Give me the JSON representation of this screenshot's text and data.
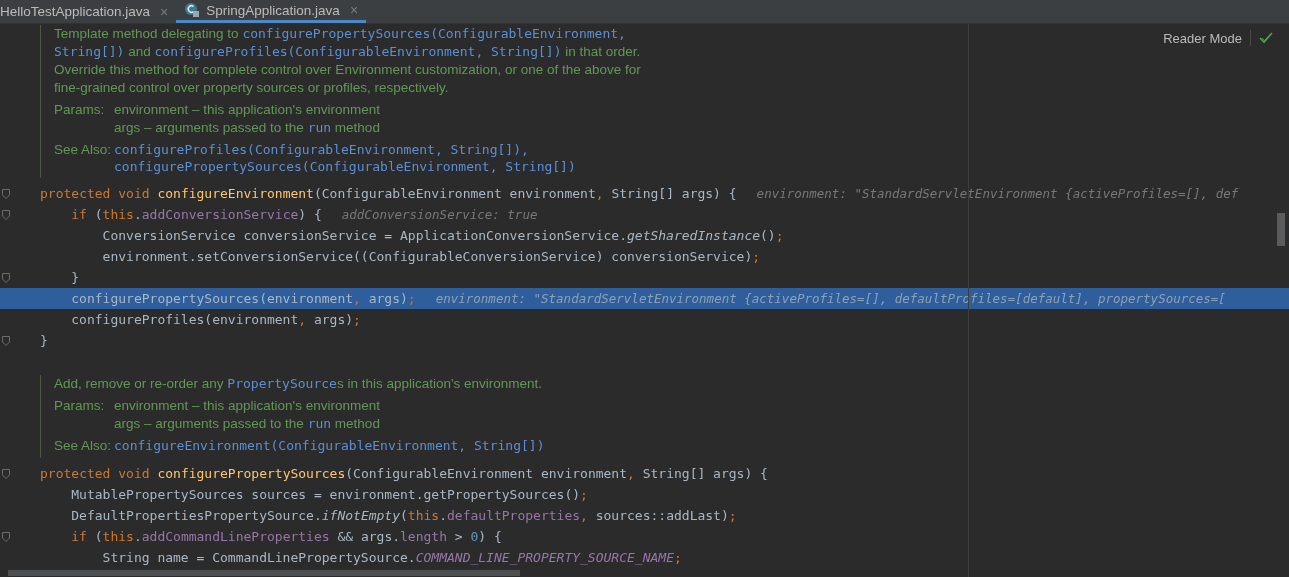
{
  "tabs": [
    {
      "label": "HelloTestApplication.java",
      "close": "×",
      "selected": false,
      "icon": false
    },
    {
      "label": "SpringApplication.java",
      "close": "×",
      "selected": true,
      "icon": true
    }
  ],
  "reader_mode": {
    "label": "Reader Mode"
  },
  "blocks": [
    {
      "kind": "doc",
      "summary": [
        [
          {
            "kind": "text",
            "text": "Template method delegating to "
          },
          {
            "kind": "code",
            "text": "configurePropertySources(ConfigurableEnvironment,"
          }
        ],
        [
          {
            "kind": "code",
            "text": "String[])"
          },
          {
            "kind": "text",
            "text": " and "
          },
          {
            "kind": "code",
            "text": "configureProfiles(ConfigurableEnvironment, String[])"
          },
          {
            "kind": "text",
            "text": " in that order."
          }
        ],
        [
          {
            "kind": "text",
            "text": "Override this method for complete control over Environment customization, or one of the above for"
          }
        ],
        [
          {
            "kind": "text",
            "text": "fine-grained control over property sources or profiles, respectively."
          }
        ]
      ],
      "params_label": "Params:",
      "params": [
        [
          {
            "kind": "text",
            "text": "environment – this application's environment"
          }
        ],
        [
          {
            "kind": "text",
            "text": "args – arguments passed to the "
          },
          {
            "kind": "code",
            "text": "run"
          },
          {
            "kind": "text",
            "text": " method"
          }
        ]
      ],
      "see_also_label": "See Also:",
      "see_also": [
        "configureProfiles(ConfigurableEnvironment, String[]),",
        "configurePropertySources(ConfigurableEnvironment, String[])"
      ]
    },
    {
      "kind": "code",
      "lines": [
        {
          "selected": false,
          "fold": true,
          "kind": "top",
          "code": [
            {
              "kind": "kw",
              "text": "protected void "
            },
            {
              "kind": "decl",
              "text": "configureEnvironment"
            },
            {
              "kind": "text",
              "text": "(ConfigurableEnvironment environment"
            },
            {
              "kind": "punct",
              "text": ", "
            },
            {
              "kind": "text",
              "text": "String[] args) {"
            }
          ],
          "hint": "environment: \"StandardServletEnvironment {activeProfiles=[], def"
        },
        {
          "selected": false,
          "fold": true,
          "kind": "body",
          "code": [
            {
              "kind": "kw",
              "text": "if "
            },
            {
              "kind": "text",
              "text": "("
            },
            {
              "kind": "kw",
              "text": "this"
            },
            {
              "kind": "text",
              "text": "."
            },
            {
              "kind": "field",
              "text": "addConversionService"
            },
            {
              "kind": "text",
              "text": ") {"
            }
          ],
          "hint": "addConversionService: true"
        },
        {
          "selected": false,
          "fold": false,
          "kind": "inner",
          "code": [
            {
              "kind": "text",
              "text": "ConversionService conversionService = ApplicationConversionService."
            },
            {
              "kind": "italic",
              "text": "getSharedInstance"
            },
            {
              "kind": "text",
              "text": "()"
            },
            {
              "kind": "punct",
              "text": ";"
            }
          ]
        },
        {
          "selected": false,
          "fold": false,
          "kind": "inner",
          "code": [
            {
              "kind": "text",
              "text": "environment.setConversionService((ConfigurableConversionService) conversionService)"
            },
            {
              "kind": "punct",
              "text": ";"
            }
          ]
        },
        {
          "selected": false,
          "fold": true,
          "kind": "body",
          "code": [
            {
              "kind": "text",
              "text": "}"
            }
          ]
        },
        {
          "selected": true,
          "fold": false,
          "kind": "body",
          "code": [
            {
              "kind": "text",
              "text": "configurePropertySources(environment"
            },
            {
              "kind": "punct",
              "text": ", "
            },
            {
              "kind": "text",
              "text": "args)"
            },
            {
              "kind": "punct",
              "text": ";"
            }
          ],
          "hint": "environment: \"StandardServletEnvironment {activeProfiles=[], defaultProfiles=[default], propertySources=["
        },
        {
          "selected": false,
          "fold": false,
          "kind": "body",
          "code": [
            {
              "kind": "text",
              "text": "configureProfiles(environment"
            },
            {
              "kind": "punct",
              "text": ", "
            },
            {
              "kind": "text",
              "text": "args)"
            },
            {
              "kind": "punct",
              "text": ";"
            }
          ]
        },
        {
          "selected": false,
          "fold": true,
          "kind": "top",
          "code": [
            {
              "kind": "text",
              "text": "}"
            }
          ]
        }
      ]
    },
    {
      "kind": "doc",
      "summary": [
        [
          {
            "kind": "text",
            "text": "Add, remove or re-order any "
          },
          {
            "kind": "code",
            "text": "PropertySource"
          },
          {
            "kind": "text",
            "text": "s in this application's environment."
          }
        ]
      ],
      "params_label": "Params:",
      "params": [
        [
          {
            "kind": "text",
            "text": "environment – this application's environment"
          }
        ],
        [
          {
            "kind": "text",
            "text": "args – arguments passed to the "
          },
          {
            "kind": "code",
            "text": "run"
          },
          {
            "kind": "text",
            "text": " method"
          }
        ]
      ],
      "see_also_label": "See Also:",
      "see_also": [
        "configureEnvironment(ConfigurableEnvironment, String[])"
      ]
    },
    {
      "kind": "code",
      "lines": [
        {
          "selected": false,
          "fold": true,
          "kind": "top",
          "code": [
            {
              "kind": "kw",
              "text": "protected void "
            },
            {
              "kind": "decl",
              "text": "configurePropertySources"
            },
            {
              "kind": "text",
              "text": "(ConfigurableEnvironment environment"
            },
            {
              "kind": "punct",
              "text": ", "
            },
            {
              "kind": "text",
              "text": "String[] args) {"
            }
          ]
        },
        {
          "selected": false,
          "fold": false,
          "kind": "body",
          "code": [
            {
              "kind": "text",
              "text": "MutablePropertySources sources = environment.getPropertySources()"
            },
            {
              "kind": "punct",
              "text": ";"
            }
          ]
        },
        {
          "selected": false,
          "fold": false,
          "kind": "body",
          "code": [
            {
              "kind": "text",
              "text": "DefaultPropertiesPropertySource."
            },
            {
              "kind": "italic",
              "text": "ifNotEmpty"
            },
            {
              "kind": "text",
              "text": "("
            },
            {
              "kind": "kw",
              "text": "this"
            },
            {
              "kind": "text",
              "text": "."
            },
            {
              "kind": "field",
              "text": "defaultProperties"
            },
            {
              "kind": "punct",
              "text": ", "
            },
            {
              "kind": "text",
              "text": "sources::addLast)"
            },
            {
              "kind": "punct",
              "text": ";"
            }
          ]
        },
        {
          "selected": false,
          "fold": true,
          "kind": "body",
          "code": [
            {
              "kind": "kw",
              "text": "if "
            },
            {
              "kind": "text",
              "text": "("
            },
            {
              "kind": "kw",
              "text": "this"
            },
            {
              "kind": "text",
              "text": "."
            },
            {
              "kind": "field",
              "text": "addCommandLineProperties"
            },
            {
              "kind": "text",
              "text": " && args."
            },
            {
              "kind": "field",
              "text": "length"
            },
            {
              "kind": "text",
              "text": " > "
            },
            {
              "kind": "num",
              "text": "0"
            },
            {
              "kind": "text",
              "text": ") {"
            }
          ]
        },
        {
          "selected": false,
          "fold": false,
          "kind": "inner",
          "code": [
            {
              "kind": "text",
              "text": "String name = CommandLinePropertySource."
            },
            {
              "kind": "const",
              "text": "COMMAND_LINE_PROPERTY_SOURCE_NAME"
            },
            {
              "kind": "punct",
              "text": ";"
            }
          ]
        }
      ]
    }
  ]
}
